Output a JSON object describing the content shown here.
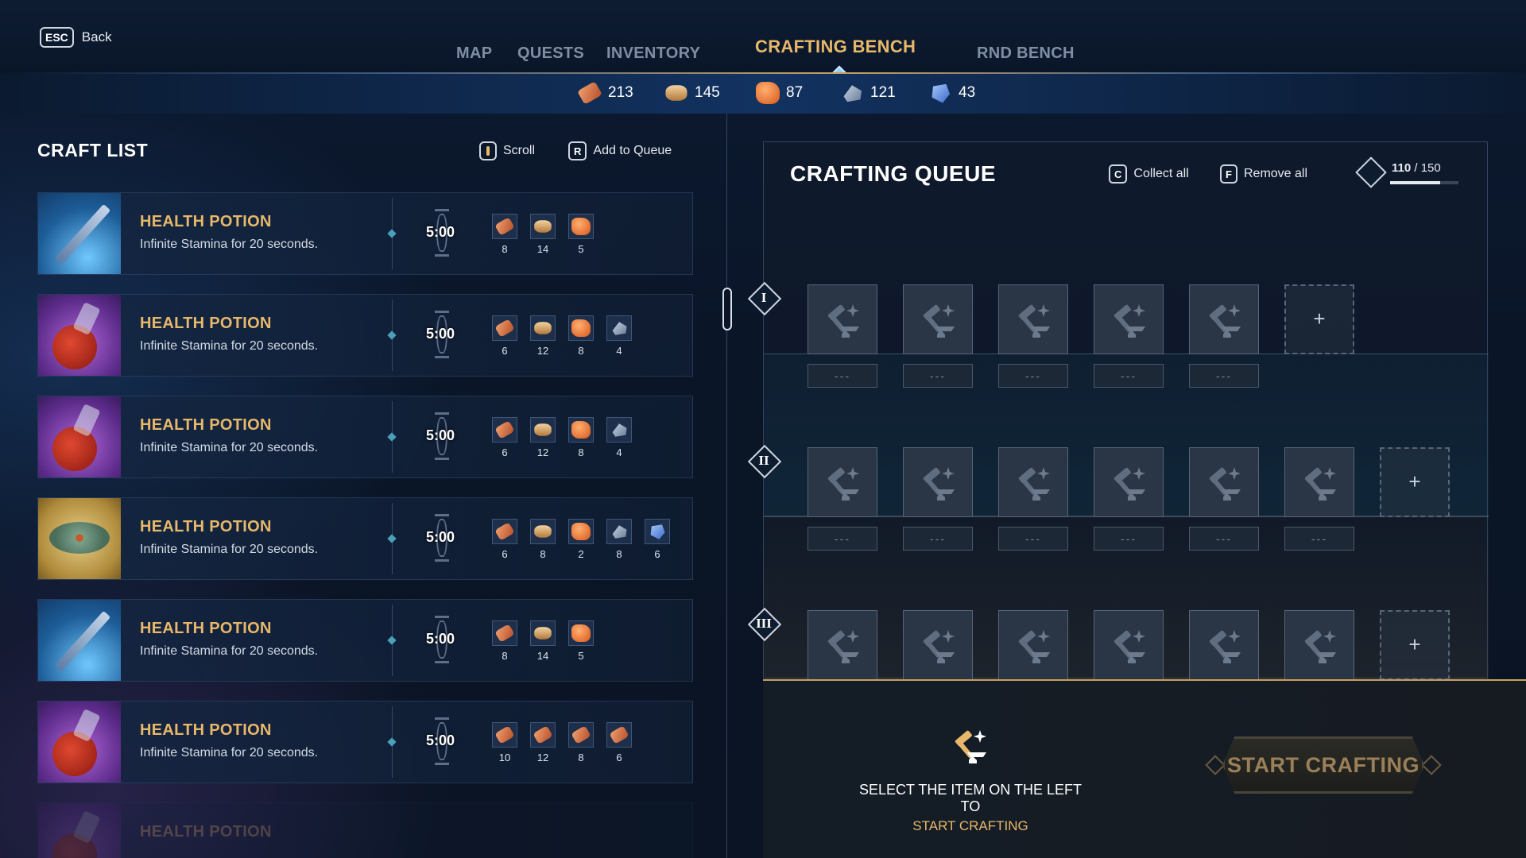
{
  "nav": {
    "back_key": "ESC",
    "back_label": "Back",
    "tabs": [
      {
        "label": "MAP",
        "active": false
      },
      {
        "label": "QUESTS",
        "active": false
      },
      {
        "label": "INVENTORY",
        "active": false
      },
      {
        "label": "CRAFTING BENCH",
        "active": true
      },
      {
        "label": "RND BENCH",
        "active": false
      }
    ]
  },
  "resources": [
    {
      "icon": "log-icon",
      "count": "213"
    },
    {
      "icon": "plank-icon",
      "count": "145"
    },
    {
      "icon": "ore-icon",
      "count": "87"
    },
    {
      "icon": "metal-icon",
      "count": "121"
    },
    {
      "icon": "crystal-icon",
      "count": "43"
    }
  ],
  "craft_list": {
    "title": "CRAFT LIST",
    "scroll_label": "Scroll",
    "queue_key": "R",
    "queue_label": "Add to Queue",
    "items": [
      {
        "name": "HEALTH POTION",
        "desc": "Infinite Stamina for 20 seconds.",
        "time": "5:00",
        "thumb": "rifle",
        "ingredients": [
          {
            "icon": "log-icon",
            "qty": "8"
          },
          {
            "icon": "plank-icon",
            "qty": "14"
          },
          {
            "icon": "ore-icon",
            "qty": "5"
          }
        ]
      },
      {
        "name": "HEALTH POTION",
        "desc": "Infinite Stamina for 20 seconds.",
        "time": "5:00",
        "thumb": "potion",
        "ingredients": [
          {
            "icon": "log-icon",
            "qty": "6"
          },
          {
            "icon": "plank-icon",
            "qty": "12"
          },
          {
            "icon": "ore-icon",
            "qty": "8"
          },
          {
            "icon": "metal-icon",
            "qty": "4"
          }
        ]
      },
      {
        "name": "HEALTH POTION",
        "desc": "Infinite Stamina for 20 seconds.",
        "time": "5:00",
        "thumb": "potion",
        "ingredients": [
          {
            "icon": "log-icon",
            "qty": "6"
          },
          {
            "icon": "plank-icon",
            "qty": "12"
          },
          {
            "icon": "ore-icon",
            "qty": "8"
          },
          {
            "icon": "metal-icon",
            "qty": "4"
          }
        ]
      },
      {
        "name": "HEALTH POTION",
        "desc": "Infinite Stamina for 20 seconds.",
        "time": "5:00",
        "thumb": "mine",
        "ingredients": [
          {
            "icon": "log-icon",
            "qty": "6"
          },
          {
            "icon": "plank-icon",
            "qty": "8"
          },
          {
            "icon": "ore-icon",
            "qty": "2"
          },
          {
            "icon": "metal-icon",
            "qty": "8"
          },
          {
            "icon": "crystal-icon",
            "qty": "6"
          }
        ]
      },
      {
        "name": "HEALTH POTION",
        "desc": "Infinite Stamina for 20 seconds.",
        "time": "5:00",
        "thumb": "rifle",
        "ingredients": [
          {
            "icon": "log-icon",
            "qty": "8"
          },
          {
            "icon": "plank-icon",
            "qty": "14"
          },
          {
            "icon": "ore-icon",
            "qty": "5"
          }
        ]
      },
      {
        "name": "HEALTH POTION",
        "desc": "Infinite Stamina for 20 seconds.",
        "time": "5:00",
        "thumb": "potion",
        "ingredients": [
          {
            "icon": "log-icon",
            "qty": "10"
          },
          {
            "icon": "log-icon",
            "qty": "12"
          },
          {
            "icon": "log-icon",
            "qty": "8"
          },
          {
            "icon": "log-icon",
            "qty": "6"
          }
        ]
      },
      {
        "name": "HEALTH POTION",
        "desc": "",
        "time": "",
        "thumb": "potion",
        "ingredients": []
      }
    ]
  },
  "queue": {
    "title": "CRAFTING QUEUE",
    "collect_key": "C",
    "collect_label": "Collect all",
    "remove_key": "F",
    "remove_label": "Remove all",
    "capacity_used": "110",
    "capacity_total": "/ 150",
    "capacity_fraction": 0.733,
    "slot_placeholder": "---",
    "add_symbol": "+",
    "rows": [
      {
        "numeral": "I",
        "slots": 5
      },
      {
        "numeral": "II",
        "slots": 6
      },
      {
        "numeral": "III",
        "slots": 6
      }
    ]
  },
  "footer": {
    "hint_line1": "SELECT THE ITEM ON THE LEFT TO",
    "hint_line2": "START CRAFTING",
    "start_label": "START CRAFTING"
  }
}
